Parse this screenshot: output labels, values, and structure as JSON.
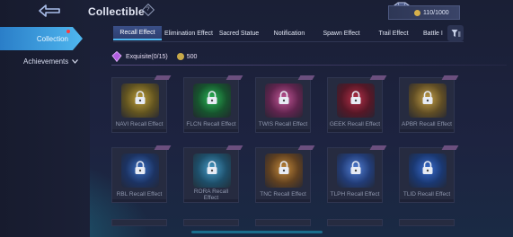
{
  "header": {
    "title": "Collectible",
    "help_icon": "?",
    "currency": {
      "icon": "diamond-icon",
      "value": "110/1000"
    }
  },
  "sidebar": {
    "items": [
      {
        "label": "Collection",
        "active": true,
        "notification": true
      },
      {
        "label": "Achievements",
        "expandable": true
      }
    ]
  },
  "tabs": [
    {
      "label": "Recall Effect",
      "active": true
    },
    {
      "label": "Elimination Effect"
    },
    {
      "label": "Sacred Statue"
    },
    {
      "label": "Notification"
    },
    {
      "label": "Spawn Effect"
    },
    {
      "label": "Trail Effect"
    },
    {
      "label": "Battle I"
    }
  ],
  "section": {
    "label": "Exquisite(0/15)",
    "cost": "500"
  },
  "items": [
    {
      "label": "NAVI Recall Effect",
      "color": "#b89a2a"
    },
    {
      "label": "FLCN Recall Effect",
      "color": "#1f8f3a"
    },
    {
      "label": "TWIS Recall Effect",
      "color": "#c04a8c"
    },
    {
      "label": "GEEK Recall Effect",
      "color": "#b0243a"
    },
    {
      "label": "APBR Recall Effect",
      "color": "#c49a3a"
    },
    {
      "label": "RBL Recall Effect",
      "color": "#2f5fb0"
    },
    {
      "label": "RORA Recall Effect",
      "color": "#3a8fb8"
    },
    {
      "label": "TNC Recall Effect",
      "color": "#c07a24"
    },
    {
      "label": "TLPH Recall Effect",
      "color": "#3b6fd0"
    },
    {
      "label": "TLID Recall Effect",
      "color": "#2c66c8"
    }
  ],
  "colors": {
    "accent": "#4fb7ef",
    "background": "#1b2036"
  }
}
